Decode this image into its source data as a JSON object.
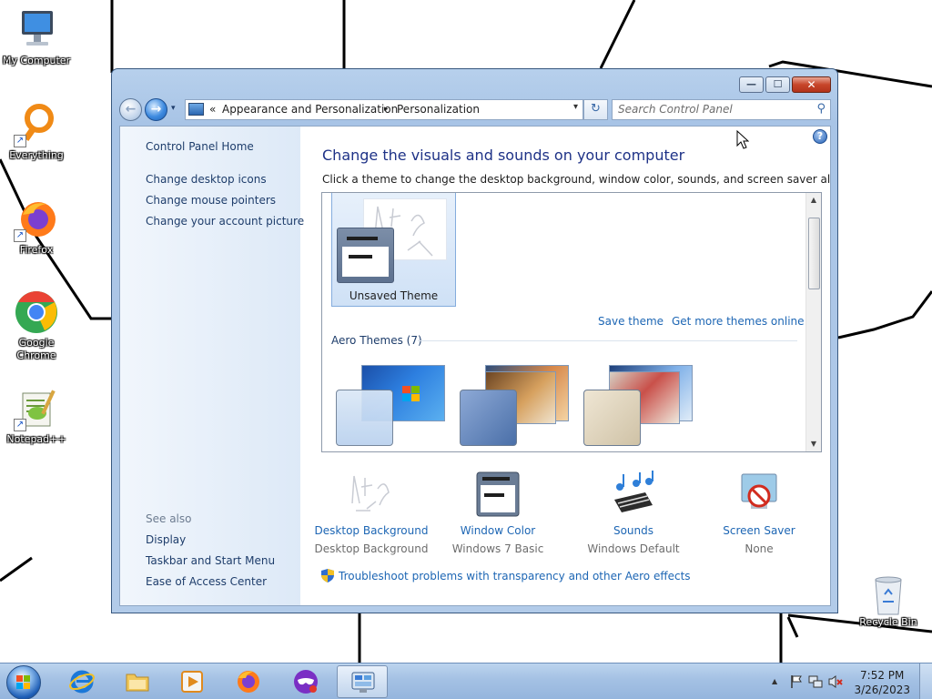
{
  "desktop": {
    "icons": [
      {
        "label": "My Computer",
        "icon": "computer-icon"
      },
      {
        "label": "Everything",
        "icon": "everything-search-icon"
      },
      {
        "label": "Firefox",
        "icon": "firefox-icon"
      },
      {
        "label": "Google Chrome",
        "icon": "chrome-icon"
      },
      {
        "label": "Notepad++",
        "icon": "notepadpp-icon"
      }
    ],
    "recycle_bin": {
      "label": "Recycle Bin",
      "icon": "recycle-bin-icon"
    }
  },
  "window": {
    "caption_buttons": {
      "minimize": "—",
      "maximize": "☐",
      "close": "✕"
    },
    "nav": {
      "back": "back-arrow-icon",
      "forward": "forward-arrow-icon",
      "breadcrumb_prefix": "«",
      "breadcrumb": [
        "Appearance and Personalization",
        "Personalization"
      ],
      "separator": "▸",
      "dropdown": "▾",
      "refresh": "↻",
      "search_placeholder": "Search Control Panel"
    },
    "left_pane": {
      "home": "Control Panel Home",
      "links": [
        "Change desktop icons",
        "Change mouse pointers",
        "Change your account picture"
      ],
      "see_also_title": "See also",
      "see_also": [
        "Display",
        "Taskbar and Start Menu",
        "Ease of Access Center"
      ]
    },
    "main": {
      "help": "?",
      "title": "Change the visuals and sounds on your computer",
      "subtitle": "Click a theme to change the desktop background, window color, sounds, and screen saver all at once.",
      "selected_theme": "Unsaved Theme",
      "save_theme": "Save theme",
      "get_more": "Get more themes online",
      "aero_title": "Aero Themes (7)",
      "bottom": [
        {
          "title": "Desktop Background",
          "value": "Desktop Background",
          "icon": "wallpaper-sketch-icon"
        },
        {
          "title": "Window Color",
          "value": "Windows 7 Basic",
          "icon": "window-color-icon"
        },
        {
          "title": "Sounds",
          "value": "Windows Default",
          "icon": "music-notes-icon"
        },
        {
          "title": "Screen Saver",
          "value": "None",
          "icon": "screen-saver-icon"
        }
      ],
      "troubleshoot": "Troubleshoot problems with transparency and other Aero effects"
    }
  },
  "taskbar": {
    "apps": [
      "explorer-folder-icon",
      "internet-explorer-icon",
      "media-player-icon",
      "firefox-icon",
      "privacy-mask-icon",
      "control-panel-icon"
    ],
    "tray_arrow": "▲",
    "time": "7:52 PM",
    "date": "3/26/2023"
  }
}
